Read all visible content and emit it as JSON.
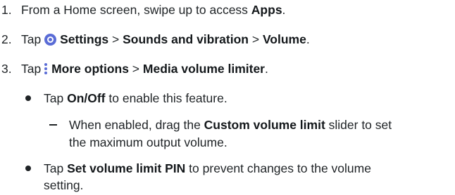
{
  "steps": [
    {
      "number": "1.",
      "text_before": "From a Home screen, swipe up to access ",
      "bold": "Apps",
      "text_after": "."
    },
    {
      "number": "2.",
      "text_before": "Tap ",
      "icon": "settings-gear-icon",
      "bold1": "Settings",
      "sep1": " > ",
      "bold2": "Sounds and vibration",
      "sep2": " > ",
      "bold3": "Volume",
      "text_after": "."
    },
    {
      "number": "3.",
      "text_before": "Tap ",
      "icon": "more-options-icon",
      "bold1": "More options",
      "sep1": " > ",
      "bold2": "Media volume limiter",
      "text_after": "."
    }
  ],
  "bullets": [
    {
      "text_before": "Tap ",
      "bold": "On/Off",
      "text_after": " to enable this feature."
    },
    {
      "text_before": "Tap ",
      "bold": "Set volume limit PIN",
      "text_after_line1": " to prevent changes to the volume",
      "text_line2": "setting."
    }
  ],
  "subitem": {
    "text_before": "When enabled, drag the ",
    "bold": "Custom volume limit",
    "text_after_line1": " slider to set",
    "text_line2": "the maximum output volume."
  },
  "colors": {
    "icon_accent": "#5a6cd6",
    "text": "#1f2326"
  }
}
